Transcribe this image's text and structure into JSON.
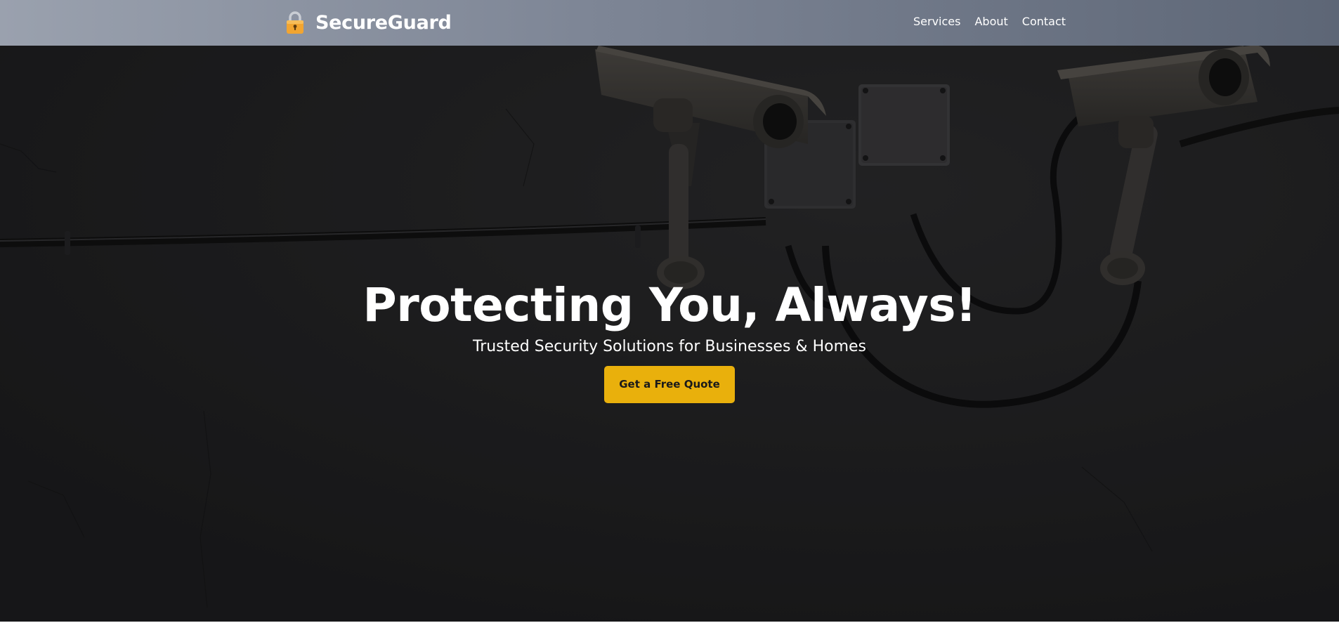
{
  "header": {
    "logo_icon": "padlock-icon",
    "brand_name": "SecureGuard",
    "nav": [
      {
        "label": "Services"
      },
      {
        "label": "About"
      },
      {
        "label": "Contact"
      }
    ]
  },
  "hero": {
    "title": "Protecting You, Always!",
    "subtitle": "Trusted Security Solutions for Businesses & Homes",
    "cta_label": "Get a Free Quote",
    "background": "security-cameras-on-dark-wall",
    "accent_color": "#e9b00c"
  }
}
